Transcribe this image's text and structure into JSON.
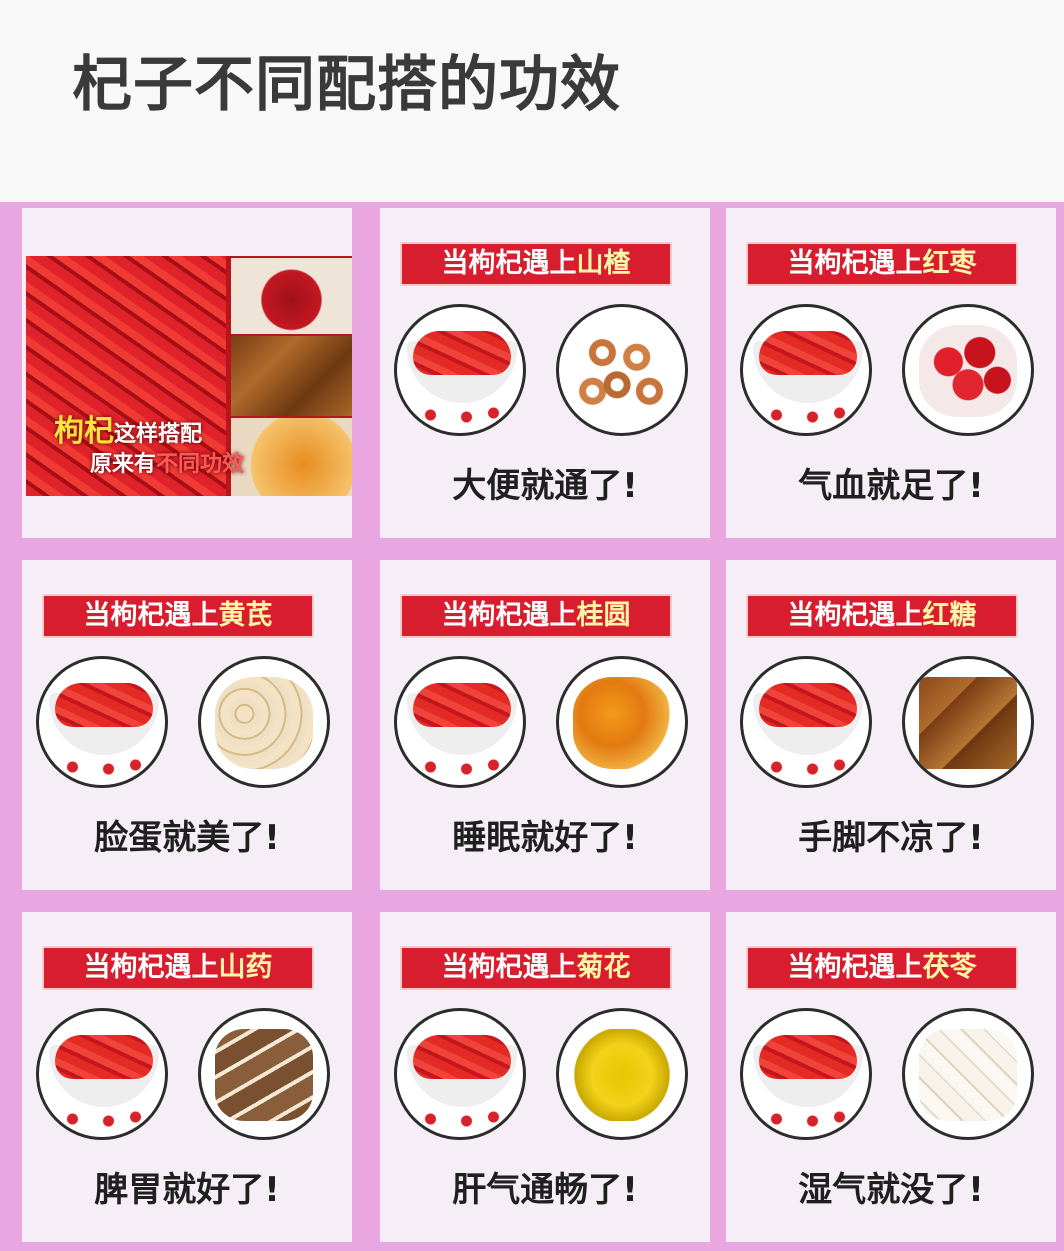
{
  "title": "杞子不同配搭的功效",
  "intro": {
    "line1_big": "枸杞",
    "line1_small": "这样搭配",
    "line2_prefix": "原来有",
    "line2_red": "不同功效"
  },
  "banner_prefix": "当枸杞遇上",
  "cards": [
    {
      "ingredient": "山楂",
      "icon": "hawthorn-slices-icon",
      "effect": "大便就通了!"
    },
    {
      "ingredient": "红枣",
      "icon": "red-dates-icon",
      "effect": "气血就足了!"
    },
    {
      "ingredient": "黄芪",
      "icon": "astragalus-slices-icon",
      "effect": "脸蛋就美了!"
    },
    {
      "ingredient": "桂圆",
      "icon": "longan-icon",
      "effect": "睡眠就好了!"
    },
    {
      "ingredient": "红糖",
      "icon": "brown-sugar-icon",
      "effect": "手脚不凉了!"
    },
    {
      "ingredient": "山药",
      "icon": "yam-icon",
      "effect": "脾胃就好了!"
    },
    {
      "ingredient": "菊花",
      "icon": "chrysanthemum-icon",
      "effect": "肝气通畅了!"
    },
    {
      "ingredient": "茯苓",
      "icon": "poria-cubes-icon",
      "effect": "湿气就没了!"
    }
  ],
  "colors": {
    "banner_red": "#d81e2e",
    "background_pink": "#e9a6e0",
    "card": "#f6eef6"
  }
}
